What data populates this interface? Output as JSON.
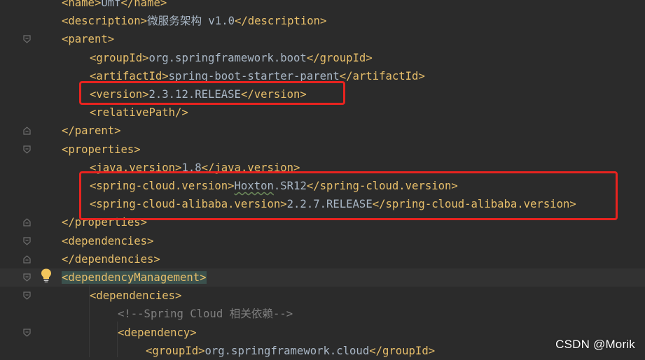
{
  "editor": {
    "lines": [
      {
        "indent": 1,
        "parts": [
          {
            "t": "tag",
            "v": "<name>"
          },
          {
            "t": "txt",
            "v": "Umf"
          },
          {
            "t": "tag",
            "v": "</name>"
          }
        ]
      },
      {
        "indent": 1,
        "parts": [
          {
            "t": "tag",
            "v": "<description>"
          },
          {
            "t": "txt",
            "v": "微服务架构 v1.0"
          },
          {
            "t": "tag",
            "v": "</description>"
          }
        ]
      },
      {
        "indent": 1,
        "fold": "open",
        "parts": [
          {
            "t": "tag",
            "v": "<parent>"
          }
        ]
      },
      {
        "indent": 2,
        "parts": [
          {
            "t": "tag",
            "v": "<groupId>"
          },
          {
            "t": "txt",
            "v": "org.springframework.boot"
          },
          {
            "t": "tag",
            "v": "</groupId>"
          }
        ]
      },
      {
        "indent": 2,
        "parts": [
          {
            "t": "tag",
            "v": "<artifactId>"
          },
          {
            "t": "txt",
            "v": "spring-boot-starter-parent"
          },
          {
            "t": "tag",
            "v": "</artifactId>"
          }
        ]
      },
      {
        "indent": 2,
        "parts": [
          {
            "t": "tag",
            "v": "<version>"
          },
          {
            "t": "txt",
            "v": "2.3.12.RELEASE"
          },
          {
            "t": "tag",
            "v": "</version>"
          }
        ]
      },
      {
        "indent": 2,
        "parts": [
          {
            "t": "tag",
            "v": "<relativePath/>"
          }
        ]
      },
      {
        "indent": 1,
        "fold": "close",
        "parts": [
          {
            "t": "tag",
            "v": "</parent>"
          }
        ]
      },
      {
        "indent": 1,
        "fold": "open",
        "parts": [
          {
            "t": "tag",
            "v": "<properties>"
          }
        ]
      },
      {
        "indent": 2,
        "parts": [
          {
            "t": "tag",
            "v": "<java.version>"
          },
          {
            "t": "txt",
            "v": "1.8"
          },
          {
            "t": "tag",
            "v": "</java.version>"
          }
        ]
      },
      {
        "indent": 2,
        "parts": [
          {
            "t": "tag",
            "v": "<spring-cloud.version>"
          },
          {
            "t": "typo",
            "v": "Hoxton"
          },
          {
            "t": "txt",
            "v": ".SR12"
          },
          {
            "t": "tag",
            "v": "</spring-cloud.version>"
          }
        ]
      },
      {
        "indent": 2,
        "parts": [
          {
            "t": "tag",
            "v": "<spring-cloud-alibaba.version>"
          },
          {
            "t": "txt",
            "v": "2.2.7.RELEASE"
          },
          {
            "t": "tag",
            "v": "</spring-cloud-alibaba.version>"
          }
        ]
      },
      {
        "indent": 1,
        "fold": "close",
        "parts": [
          {
            "t": "tag",
            "v": "</properties>"
          }
        ]
      },
      {
        "indent": 1,
        "fold": "open",
        "parts": [
          {
            "t": "tag",
            "v": "<dependencies>"
          }
        ]
      },
      {
        "indent": 1,
        "fold": "close",
        "parts": [
          {
            "t": "tag",
            "v": "</dependencies>"
          }
        ]
      },
      {
        "indent": 1,
        "fold": "open",
        "caret": true,
        "parts": [
          {
            "t": "taghl",
            "v": "<dependencyManagement>"
          }
        ]
      },
      {
        "indent": 2,
        "fold": "open",
        "parts": [
          {
            "t": "tag",
            "v": "<dependencies>"
          }
        ]
      },
      {
        "indent": 3,
        "parts": [
          {
            "t": "cmt",
            "v": "<!--Spring Cloud 相关依赖-->"
          }
        ]
      },
      {
        "indent": 3,
        "fold": "open",
        "parts": [
          {
            "t": "tag",
            "v": "<dependency>"
          }
        ]
      },
      {
        "indent": 4,
        "parts": [
          {
            "t": "tag",
            "v": "<groupId>"
          },
          {
            "t": "txt",
            "v": "org.springframework.cloud"
          },
          {
            "t": "tag",
            "v": "</groupId>"
          }
        ]
      }
    ]
  },
  "intention_icon": "lightbulb-icon",
  "watermark": "CSDN @Morik",
  "colors": {
    "background": "#2b2b2b",
    "tag": "#e8bf6a",
    "text": "#a9b7c6",
    "comment": "#808080",
    "highlight_box": "#e8231f"
  }
}
